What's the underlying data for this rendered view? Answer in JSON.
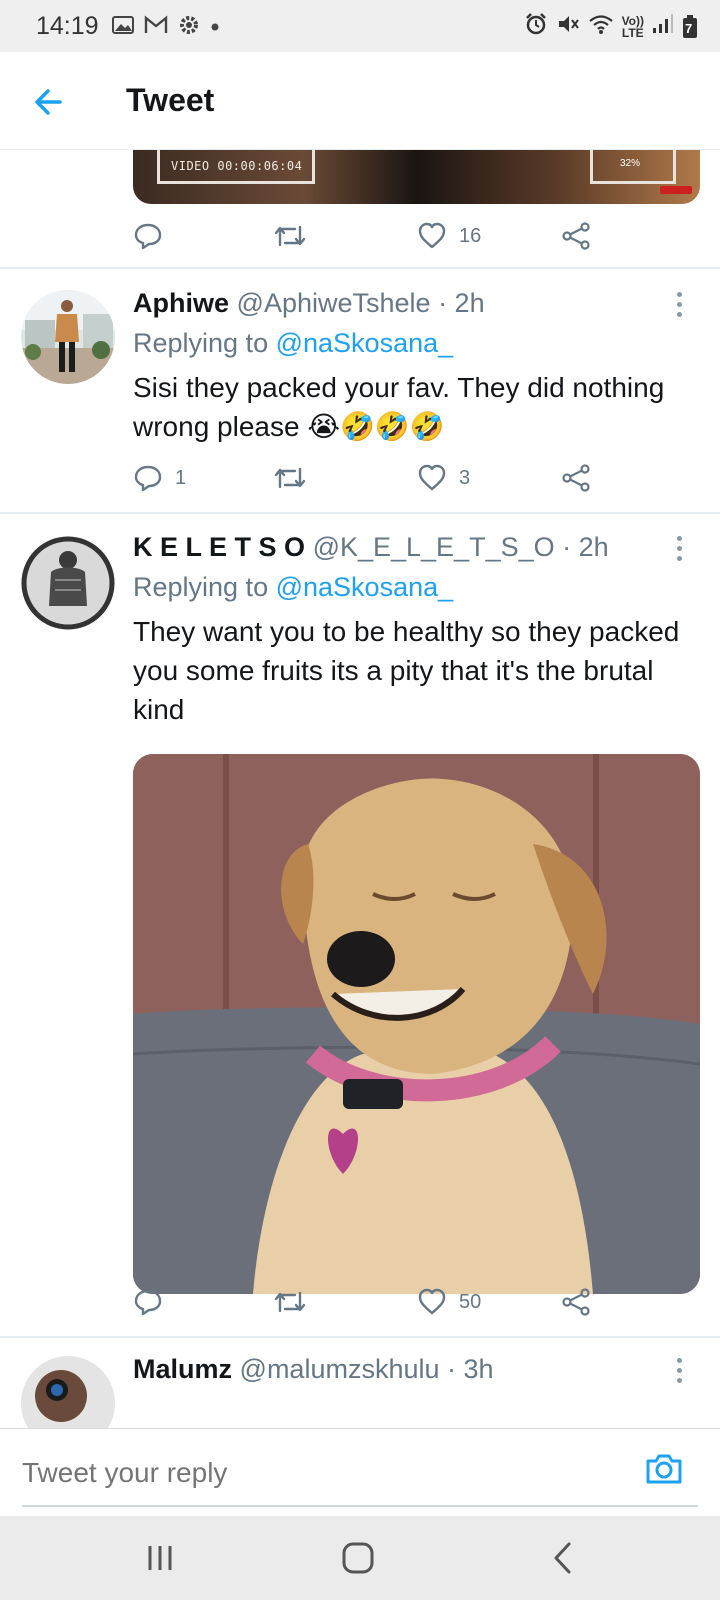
{
  "status_bar": {
    "time": "14:19",
    "volte": "Vo))",
    "lte": "LTE",
    "battery": "7",
    "left_icons": [
      "image-icon",
      "gmail-icon",
      "gear-icon",
      "dot-icon"
    ],
    "right_icons": [
      "alarm-icon",
      "mute-icon",
      "wifi-icon",
      "volte-icon",
      "signal-icon",
      "battery-icon"
    ]
  },
  "app_bar": {
    "title": "Tweet"
  },
  "video_preview": {
    "overlay_text": "VIDEO 00:00:06:04",
    "battery_text": "32%"
  },
  "colors": {
    "accent": "#1da1f2",
    "text_primary": "#14171a",
    "text_secondary": "#657786",
    "divider": "#e6ecf0"
  },
  "tweets": [
    {
      "actions": {
        "reply_count": "",
        "retweet_count": "",
        "like_count": "16"
      }
    },
    {
      "name": "Aphiwe",
      "handle": "@AphiweTshele",
      "time": "· 2h",
      "replying_prefix": "Replying to",
      "replying_handle": "@naSkosana_",
      "text": "Sisi they packed your fav. They did nothing wrong please",
      "emoji": "😭🤣🤣🤣",
      "actions": {
        "reply_count": "1",
        "retweet_count": "",
        "like_count": "3"
      }
    },
    {
      "name": "K E L E T S O",
      "handle": "@K_E_L_E_T_S_O",
      "time": "· 2h",
      "replying_prefix": "Replying to",
      "replying_handle": "@naSkosana_",
      "text": "They want you to be healthy so they packed you some fruits its a pity that it's the brutal kind",
      "actions": {
        "reply_count": "",
        "retweet_count": "",
        "like_count": "50"
      }
    },
    {
      "name": "Malumz",
      "handle": "@malumzskhulu",
      "time": "· 3h"
    }
  ],
  "reply_bar": {
    "placeholder": "Tweet your reply"
  },
  "nav_bar": {
    "buttons": [
      "recents-icon",
      "home-icon",
      "back-icon"
    ]
  }
}
